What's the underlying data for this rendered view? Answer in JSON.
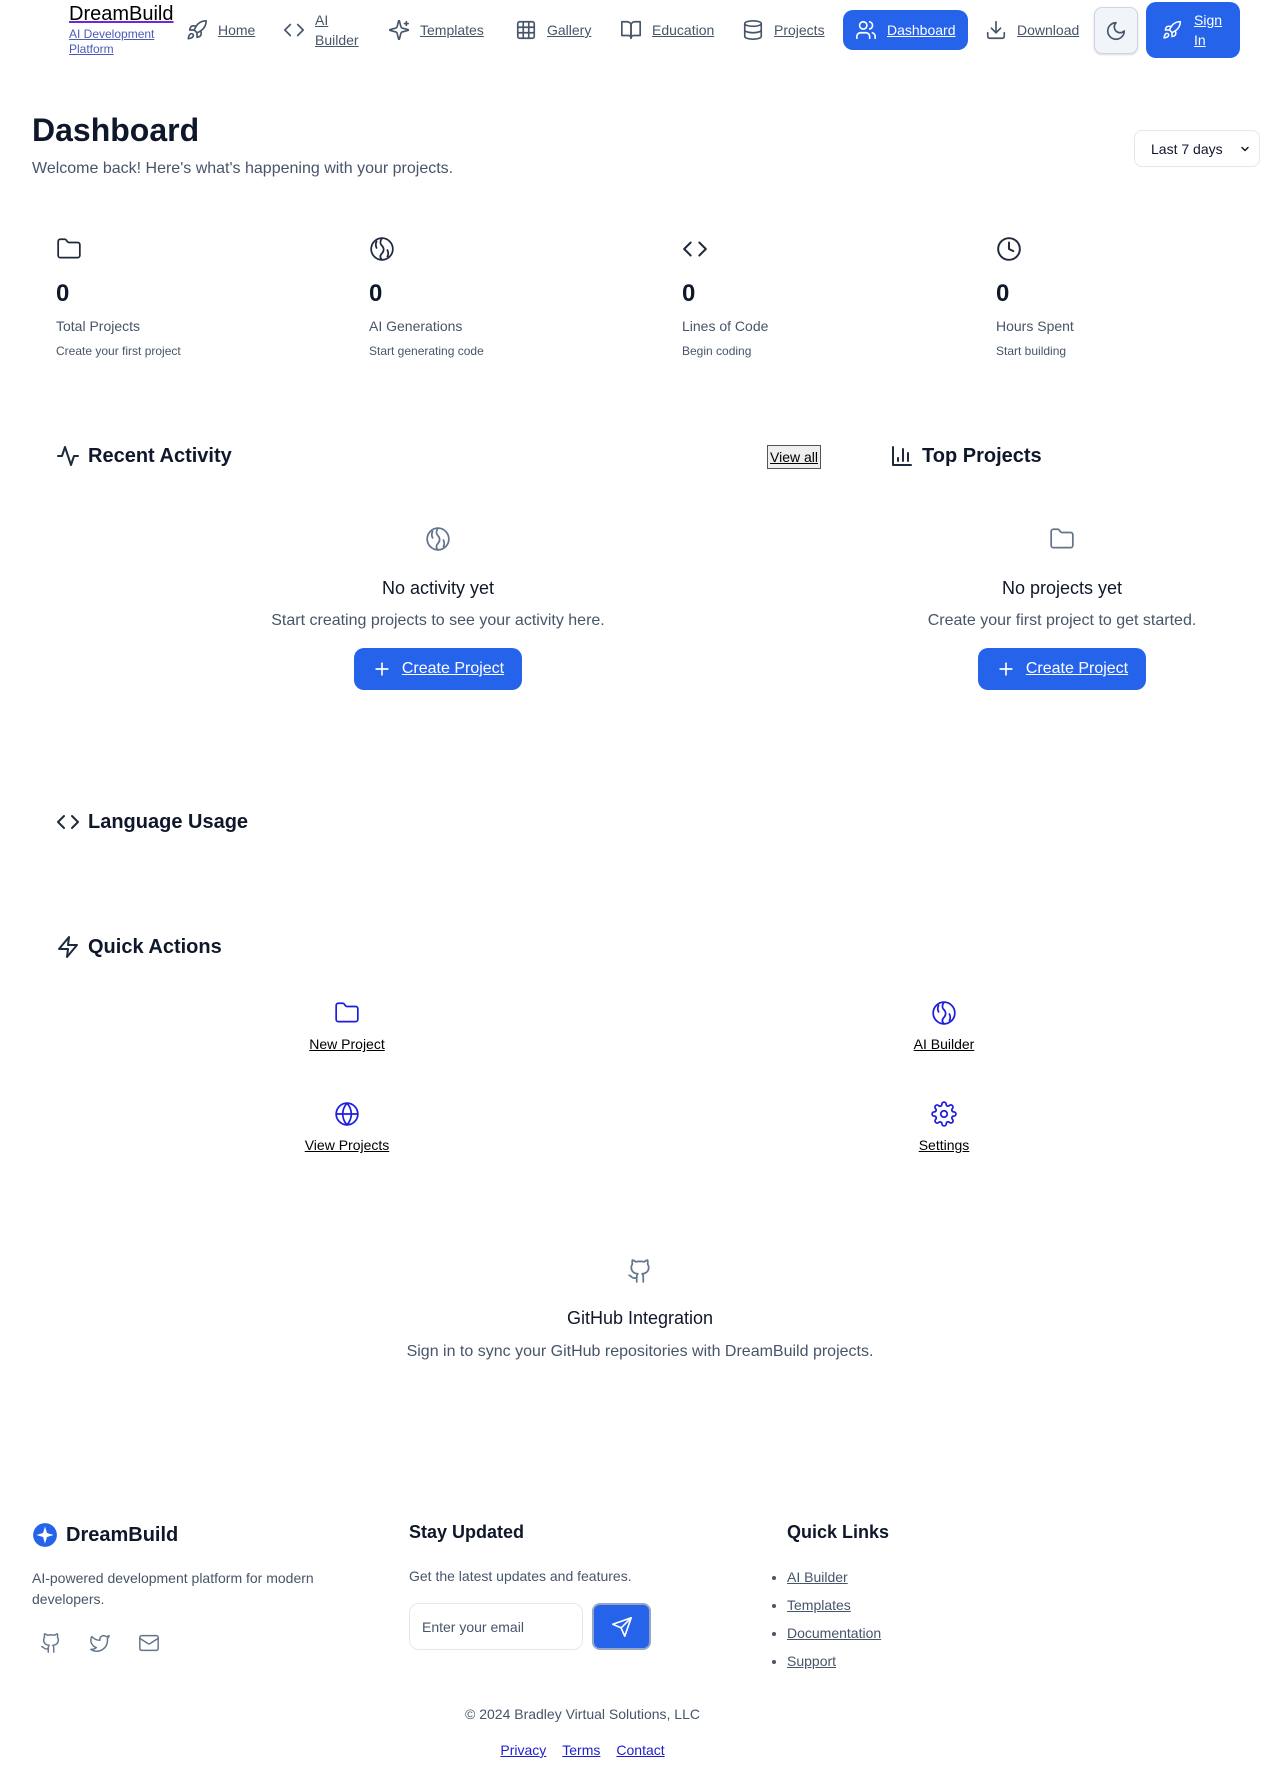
{
  "brand": {
    "name": "DreamBuild",
    "tagline": "AI Development Platform"
  },
  "nav": {
    "items": [
      {
        "label": "Home",
        "icon": "rocket-icon"
      },
      {
        "label": "AI Builder",
        "icon": "code-icon"
      },
      {
        "label": "Templates",
        "icon": "sparkles-icon"
      },
      {
        "label": "Gallery",
        "icon": "grid-icon"
      },
      {
        "label": "Education",
        "icon": "book-icon"
      },
      {
        "label": "Projects",
        "icon": "database-icon"
      },
      {
        "label": "Dashboard",
        "icon": "users-icon",
        "active": true
      },
      {
        "label": "Download",
        "icon": "download-icon"
      }
    ],
    "theme_icon": "moon-icon",
    "sign_in": "Sign In"
  },
  "header": {
    "title": "Dashboard",
    "subtitle": "Welcome back! Here's what's happening with your projects.",
    "range": "Last 7 days"
  },
  "stats": [
    {
      "icon": "folder-icon",
      "value": "0",
      "label": "Total Projects",
      "hint": "Create your first project"
    },
    {
      "icon": "brain-icon",
      "value": "0",
      "label": "AI Generations",
      "hint": "Start generating code"
    },
    {
      "icon": "code-icon",
      "value": "0",
      "label": "Lines of Code",
      "hint": "Begin coding"
    },
    {
      "icon": "clock-icon",
      "value": "0",
      "label": "Hours Spent",
      "hint": "Start building"
    }
  ],
  "recent_activity": {
    "title": "Recent Activity",
    "view_all": "View all",
    "empty_title": "No activity yet",
    "empty_sub": "Start creating projects to see your activity here.",
    "button": "Create Project"
  },
  "top_projects": {
    "title": "Top Projects",
    "empty_title": "No projects yet",
    "empty_sub": "Create your first project to get started.",
    "button": "Create Project"
  },
  "language_usage": {
    "title": "Language Usage"
  },
  "quick_actions": {
    "title": "Quick Actions",
    "items": [
      {
        "label": "New Project",
        "icon": "folder-icon"
      },
      {
        "label": "AI Builder",
        "icon": "brain-icon"
      },
      {
        "label": "View Projects",
        "icon": "globe-icon"
      },
      {
        "label": "Settings",
        "icon": "gear-icon"
      }
    ]
  },
  "github": {
    "title": "GitHub Integration",
    "subtitle": "Sign in to sync your GitHub repositories with DreamBuild projects."
  },
  "footer": {
    "brand": "DreamBuild",
    "description": "AI-powered development platform for modern developers.",
    "newsletter_title": "Stay Updated",
    "newsletter_text": "Get the latest updates and features.",
    "email_placeholder": "Enter your email",
    "links_title": "Quick Links",
    "links": [
      "AI Builder",
      "Templates",
      "Documentation",
      "Support"
    ],
    "copyright": "© 2024 Bradley Virtual Solutions, LLC",
    "legal": [
      "Privacy",
      "Terms",
      "Contact"
    ]
  },
  "colors": {
    "accent": "#2563eb",
    "text": "#0f172a",
    "muted": "#475569"
  }
}
